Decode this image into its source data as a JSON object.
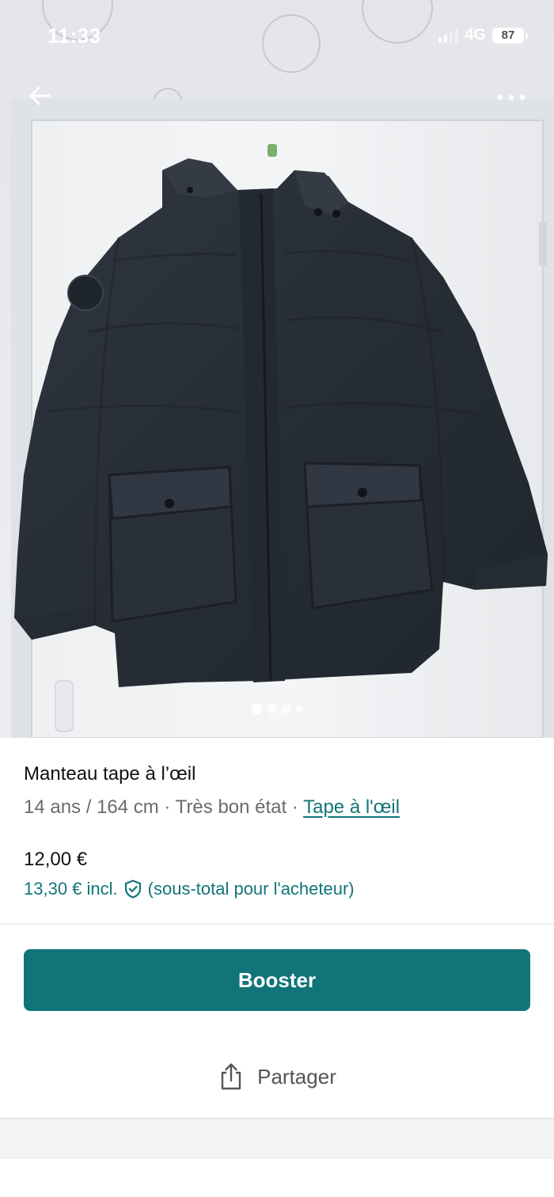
{
  "status_bar": {
    "time": "11:33",
    "network": "4G",
    "battery": "87"
  },
  "nav": {
    "back_icon": "arrow-left-icon",
    "more_icon": "more-horizontal-icon"
  },
  "gallery": {
    "image_count": 4,
    "active_index": 0
  },
  "item": {
    "title": "Manteau tape à l’œil",
    "size": "14 ans / 164 cm",
    "sep1": " · ",
    "condition": "Très bon état",
    "sep2": " · ",
    "brand": "Tape à l'œil",
    "price": "12,00 €",
    "buyer_price": "13,30 € incl.",
    "buyer_note": "(sous-total pour l'acheteur)"
  },
  "actions": {
    "booster_label": "Booster",
    "share_label": "Partager"
  },
  "colors": {
    "accent": "#117479",
    "jacket": "#2c333c",
    "background": "#ffffff"
  }
}
